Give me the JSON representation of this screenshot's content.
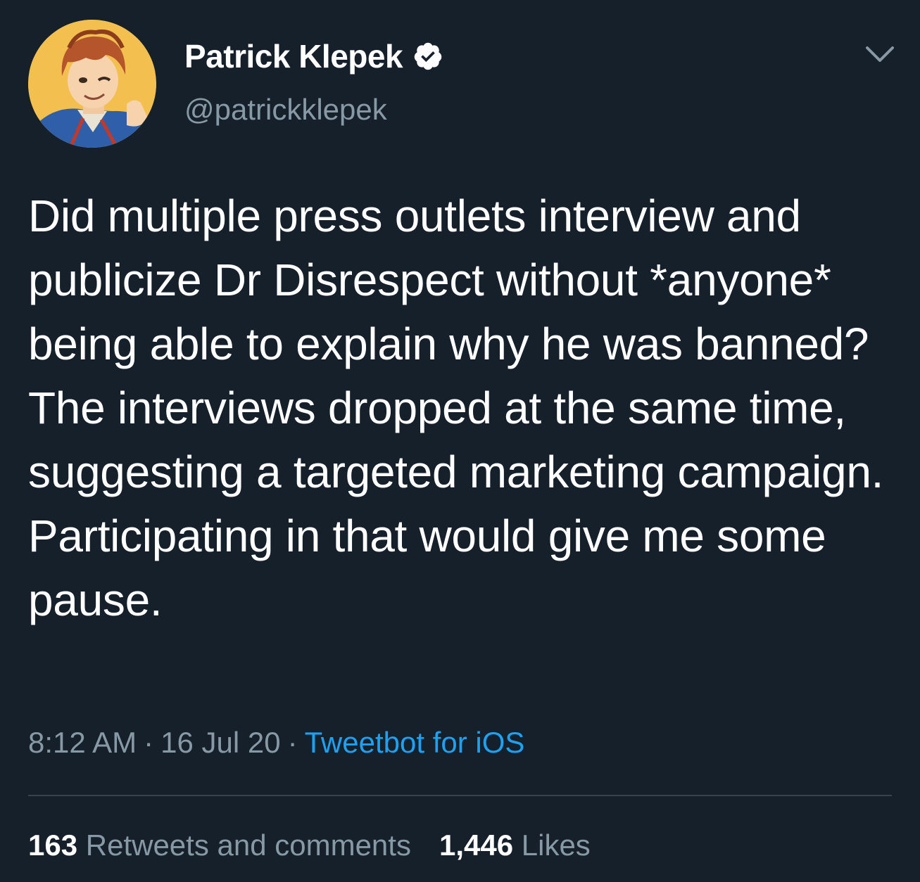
{
  "author": {
    "display_name": "Patrick Klepek",
    "handle": "@patrickklepek",
    "verified": true
  },
  "tweet": {
    "text": "Did multiple press outlets interview and publicize Dr Disrespect without *anyone* being able to explain why he was banned? The interviews dropped at the same time, suggesting a targeted marketing campaign. Participating in that would give me some pause.",
    "time": "8:12 AM",
    "date": "16 Jul 20",
    "separator": "·",
    "source": "Tweetbot for iOS"
  },
  "stats": {
    "retweets_count": "163",
    "retweets_label": "Retweets and comments",
    "likes_count": "1,446",
    "likes_label": "Likes"
  },
  "icons": {
    "verified": "verified-badge-icon",
    "menu": "chevron-down-icon"
  },
  "colors": {
    "background": "#15202b",
    "text_primary": "#ffffff",
    "text_secondary": "#8899a6",
    "link": "#1da1f2",
    "divider": "#38444d"
  }
}
